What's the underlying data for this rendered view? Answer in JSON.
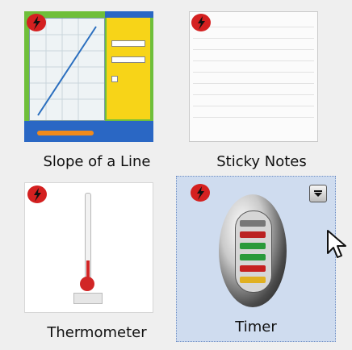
{
  "tiles": [
    {
      "caption": "Slope of a Line"
    },
    {
      "caption": "Sticky Notes"
    },
    {
      "caption": "Thermometer"
    },
    {
      "caption": "Timer"
    }
  ],
  "colors": {
    "selection": "#cfdcef",
    "flash_red": "#d42020"
  }
}
